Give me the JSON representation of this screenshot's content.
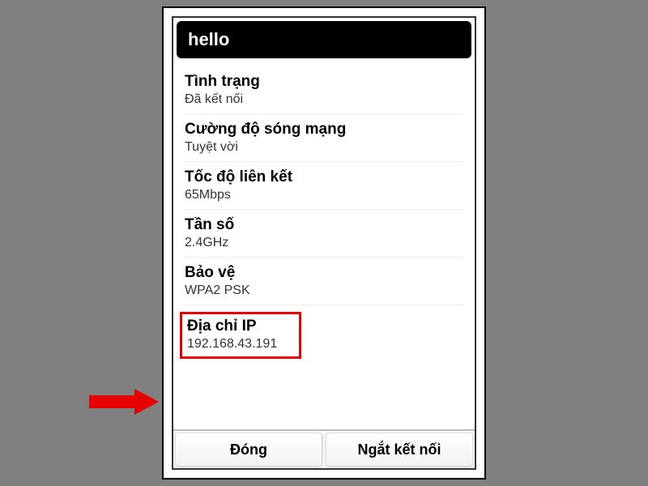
{
  "title": "hello",
  "rows": [
    {
      "label": "Tình trạng",
      "value": "Đã kết nối"
    },
    {
      "label": "Cường độ sóng mạng",
      "value": "Tuyệt vời"
    },
    {
      "label": "Tốc độ liên kết",
      "value": "65Mbps"
    },
    {
      "label": "Tần số",
      "value": "2.4GHz"
    },
    {
      "label": "Bảo vệ",
      "value": "WPA2 PSK"
    },
    {
      "label": "Địa chỉ IP",
      "value": "192.168.43.191"
    }
  ],
  "buttons": {
    "close": "Đóng",
    "disconnect": "Ngắt kết nối"
  }
}
